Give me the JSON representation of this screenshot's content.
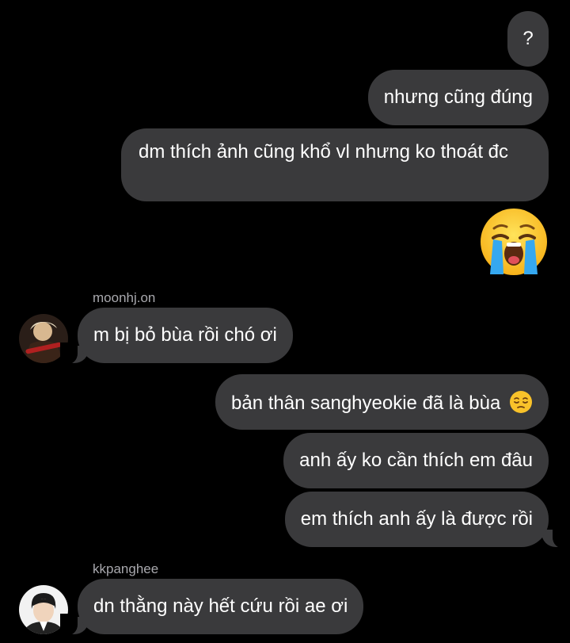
{
  "messages": {
    "m1": "?",
    "m2": "nhưng cũng đúng",
    "m3": "dm thích ảnh cũng khổ vl nhưng ko thoát đc",
    "m4_emoji": "loudly-crying-face-emoji",
    "m5_sender": "moonhj.on",
    "m5": "m bị bỏ bùa rồi chó ơi",
    "m6": "bản thân sanghyeokie đã là bùa",
    "m6_emoji": "pensive-face-emoji",
    "m7": "anh ấy ko cần thích em đâu",
    "m8": "em thích anh ấy là được rồi",
    "m9_sender": "kkpanghee",
    "m9": "dn thằng này hết cứu rồi ae ơi"
  },
  "colors": {
    "background": "#000000",
    "bubble": "#3a3a3c",
    "text": "#ffffff",
    "sender_text": "#a8a8ad"
  }
}
